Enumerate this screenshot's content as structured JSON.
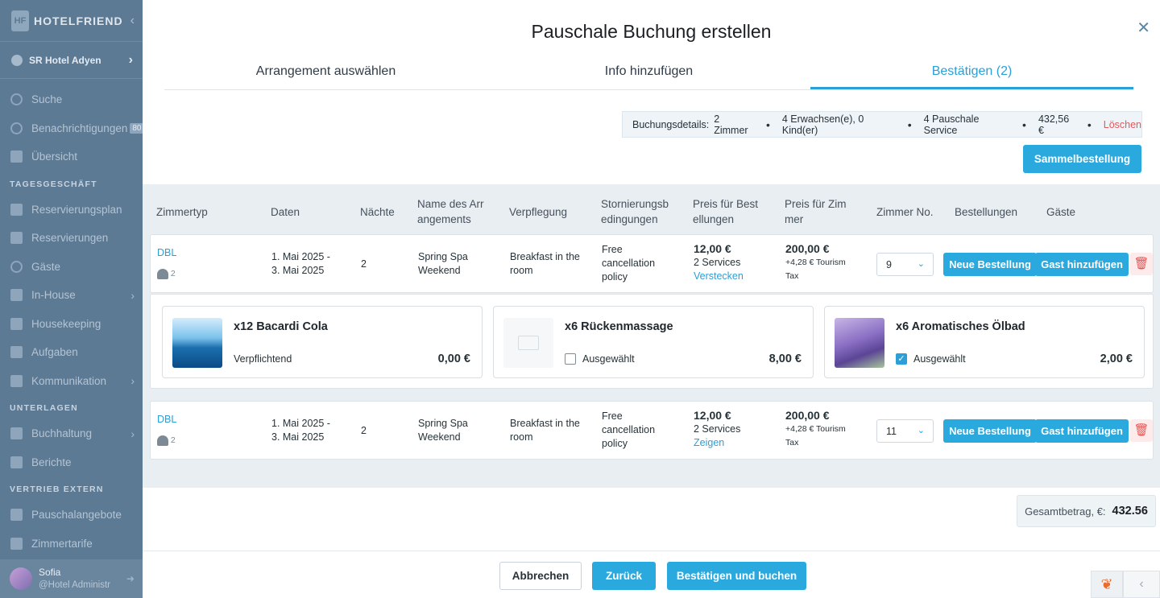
{
  "sidebar": {
    "brand": "HOTELFRIEND",
    "brand_mark": "HF",
    "hotel": "SR Hotel Adyen",
    "items_top": [
      {
        "label": "Suche",
        "icon": "search-icon"
      },
      {
        "label": "Benachrichtigungen",
        "icon": "bell-icon",
        "badge": "80"
      },
      {
        "label": "Übersicht",
        "icon": "dashboard-icon"
      }
    ],
    "section_tages": "TAGESGESCHÄFT",
    "items_tages": [
      {
        "label": "Reservierungsplan",
        "icon": "calendar-icon"
      },
      {
        "label": "Reservierungen",
        "icon": "document-icon"
      },
      {
        "label": "Gäste",
        "icon": "person-icon"
      },
      {
        "label": "In-House",
        "icon": "bed-icon"
      },
      {
        "label": "Housekeeping",
        "icon": "broom-icon"
      },
      {
        "label": "Aufgaben",
        "icon": "wrench-icon"
      },
      {
        "label": "Kommunikation",
        "icon": "chat-icon"
      }
    ],
    "section_unterlagen": "UNTERLAGEN",
    "items_unterlagen": [
      {
        "label": "Buchhaltung",
        "icon": "accounting-icon"
      },
      {
        "label": "Berichte",
        "icon": "report-icon"
      }
    ],
    "section_vertrieb": "VERTRIEB EXTERN",
    "items_vertrieb": [
      {
        "label": "Pauschalangebote",
        "icon": "tag-icon"
      },
      {
        "label": "Zimmertarife",
        "icon": "chart-icon"
      }
    ],
    "user": {
      "name": "Sofia",
      "role": "@Hotel Administr"
    }
  },
  "modal": {
    "title": "Pauschale Buchung erstellen",
    "tabs": [
      "Arrangement auswählen",
      "Info hinzufügen",
      "Bestätigen (2)"
    ],
    "summary": {
      "label": "Buchungsdetails:",
      "rooms": "2 Zimmer",
      "guests": "4 Erwachsen(e), 0 Kind(er)",
      "services": "4 Pauschale Service",
      "amount": "432,56 €",
      "delete": "Löschen"
    },
    "sammel_label": "Sammelbestellung",
    "headers": [
      "Zimmertyp",
      "Daten",
      "Nächte",
      "Name des Arr angements",
      "Verpflegung",
      "Stornierungsb edingungen",
      "Preis für Best ellungen",
      "Preis für Zim mer",
      "Zimmer No.",
      "Bestellungen",
      "Gäste"
    ],
    "rows": [
      {
        "type": "DBL",
        "guests": "2",
        "date1": "1. Mai 2025 -",
        "date2": "3. Mai 2025",
        "nights": "2",
        "arr1": "Spring Spa",
        "arr2": "Weekend",
        "meal1": "Breakfast in the",
        "meal2": "room",
        "cancel1": "Free",
        "cancel2": "cancellation",
        "cancel3": "policy",
        "order_price": "12,00 €",
        "services": "2 Services",
        "toggle": "Verstecken",
        "room_price": "200,00 €",
        "tax1": "+4,28 € Tourism",
        "tax2": "Tax",
        "room_no": "9",
        "new_order": "Neue Bestellung",
        "add_guest": "Gast hinzufügen"
      },
      {
        "type": "DBL",
        "guests": "2",
        "date1": "1. Mai 2025 -",
        "date2": "3. Mai 2025",
        "nights": "2",
        "arr1": "Spring Spa",
        "arr2": "Weekend",
        "meal1": "Breakfast in the",
        "meal2": "room",
        "cancel1": "Free",
        "cancel2": "cancellation",
        "cancel3": "policy",
        "order_price": "12,00 €",
        "services": "2 Services",
        "toggle": "Zeigen",
        "room_price": "200,00 €",
        "tax1": "+4,28 € Tourism",
        "tax2": "Tax",
        "room_no": "11",
        "new_order": "Neue Bestellung",
        "add_guest": "Gast hinzufügen"
      }
    ],
    "service_cards": [
      {
        "name": "x12 Bacardi Cola",
        "status": "Verpflichtend",
        "price": "0,00 €",
        "checkbox": false
      },
      {
        "name": "x6 Rückenmassage",
        "status": "Ausgewählt",
        "price": "8,00 €",
        "checkbox": true,
        "checked": false
      },
      {
        "name": "x6 Aromatisches Ölbad",
        "status": "Ausgewählt",
        "price": "2,00 €",
        "checkbox": true,
        "checked": true
      }
    ],
    "total": {
      "label": "Gesamtbetrag, €:",
      "value": "432.56"
    },
    "footer": {
      "cancel": "Abbrechen",
      "back": "Zurück",
      "confirm": "Bestätigen und buchen"
    }
  },
  "colors": {
    "accent": "#2aa9de",
    "sidebar": "#5d7a95",
    "danger": "#e35353"
  }
}
